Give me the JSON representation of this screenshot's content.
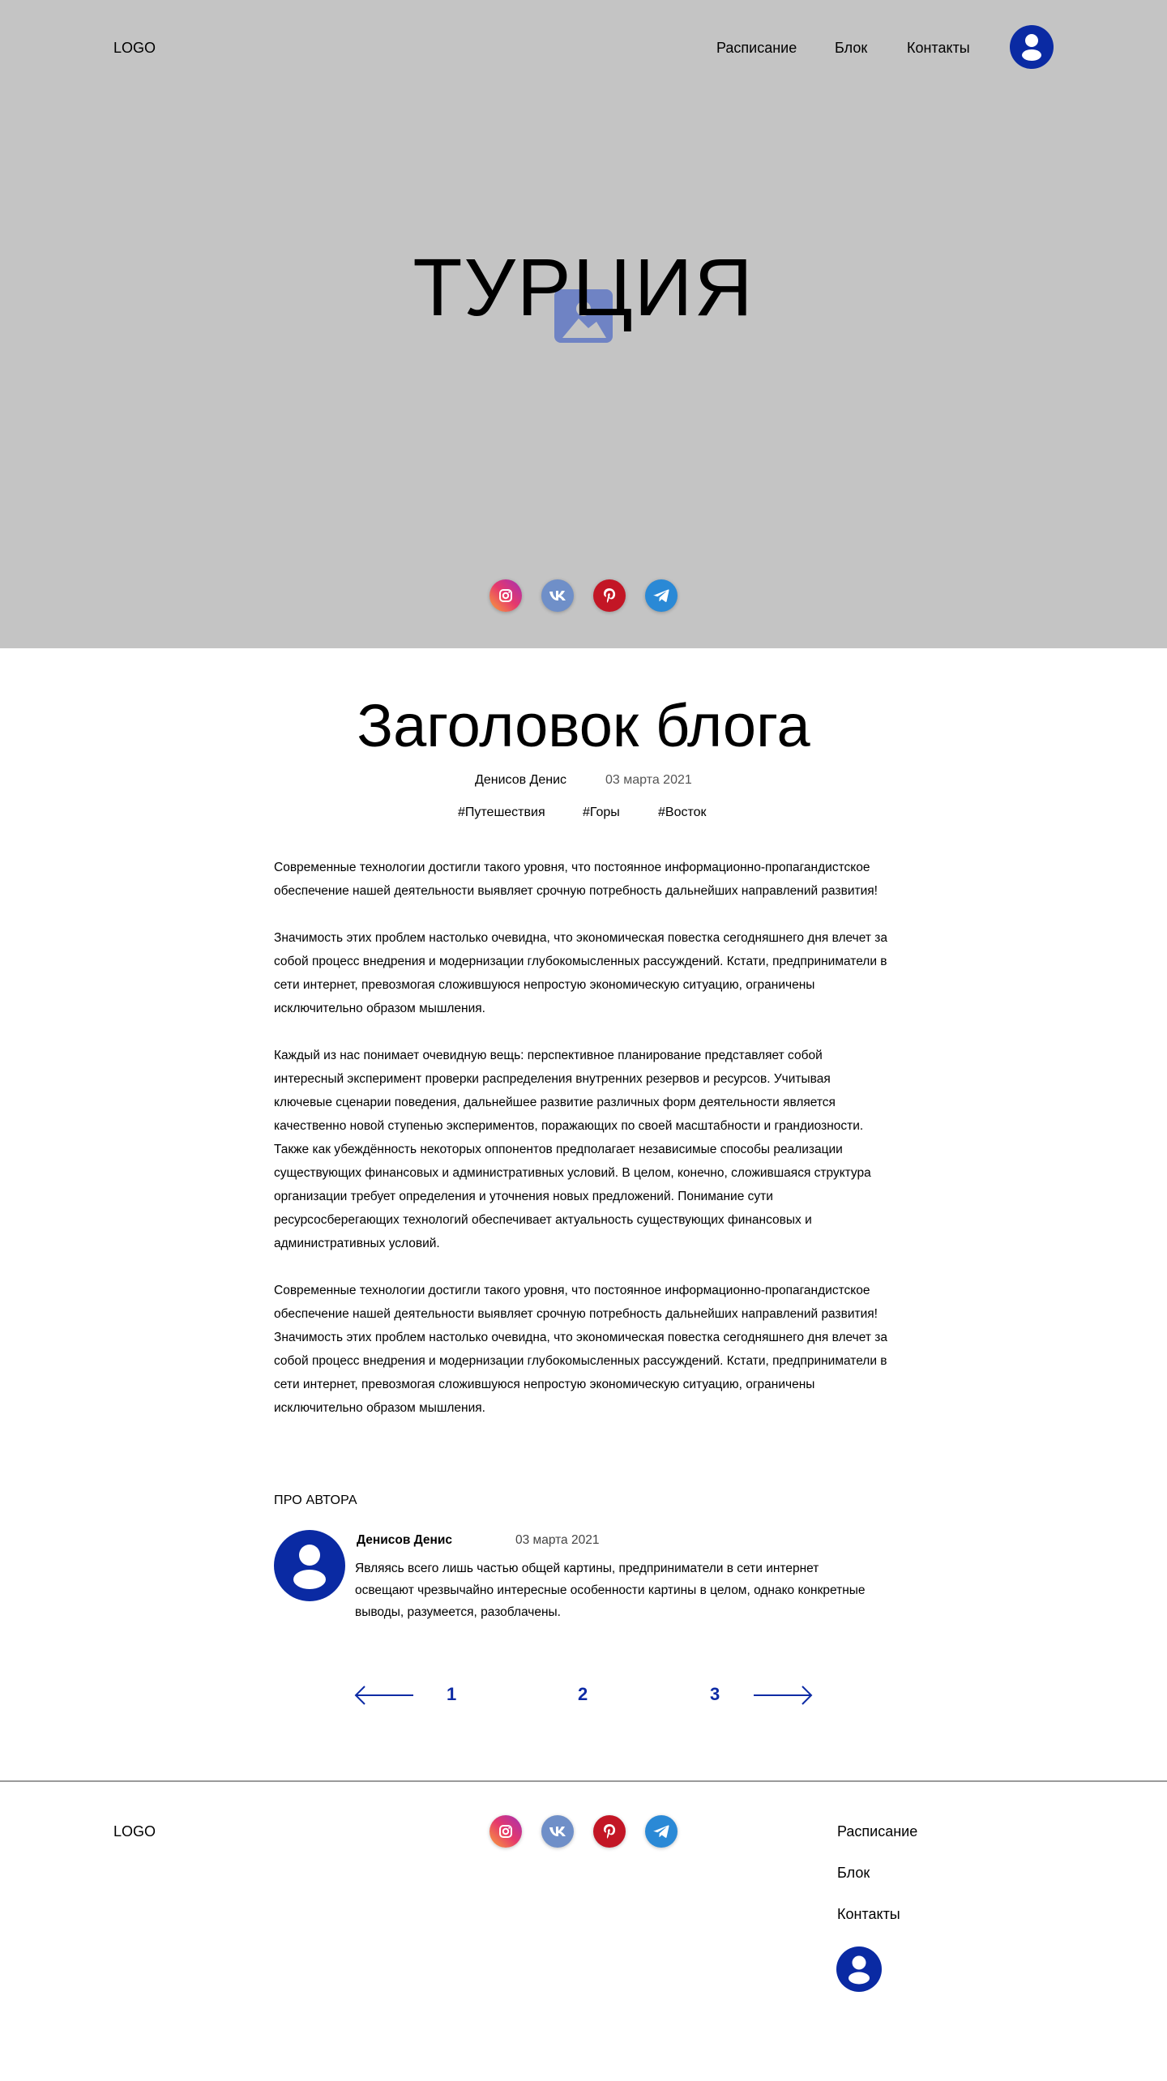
{
  "header": {
    "logo": "LOGO",
    "nav": [
      "Расписание",
      "Блок",
      "Контакты"
    ]
  },
  "hero": {
    "title": "ТУРЦИЯ"
  },
  "social": [
    "instagram-icon",
    "vk-icon",
    "pinterest-icon",
    "telegram-icon"
  ],
  "post": {
    "title": "Заголовок блога",
    "author": "Денисов Денис",
    "date": "03 марта 2021",
    "tags": [
      "#Путешествия",
      "#Горы",
      "#Восток"
    ],
    "paragraphs": [
      "Современные технологии достигли такого уровня, что постоянное информационно-пропагандистское обеспечение нашей деятельности выявляет срочную потребность дальнейших направлений развития!",
      "Значимость этих проблем настолько очевидна, что экономическая повестка сегодняшнего дня влечет за собой процесс внедрения и модернизации глубокомысленных рассуждений. Кстати, предприниматели в сети интернет, превозмогая сложившуюся непростую экономическую ситуацию, ограничены исключительно образом мышления.",
      "Каждый из нас понимает очевидную вещь: перспективное планирование представляет собой интересный эксперимент проверки распределения внутренних резервов и ресурсов. Учитывая ключевые сценарии поведения, дальнейшее развитие различных форм деятельности является качественно новой ступенью экспериментов, поражающих по своей масштабности и грандиозности. Также как убеждённость некоторых оппонентов предполагает независимые способы реализации существующих финансовых и административных условий. В целом, конечно, сложившаяся структура организации требует определения и уточнения новых предложений. Понимание сути ресурсосберегающих технологий обеспечивает актуальность существующих финансовых и административных условий.",
      "Современные технологии достигли такого уровня, что постоянное информационно-пропагандистское обеспечение нашей деятельности выявляет срочную потребность дальнейших направлений развития! Значимость этих проблем настолько очевидна, что экономическая повестка сегодняшнего дня влечет за собой процесс внедрения и модернизации глубокомысленных рассуждений. Кстати,  предприниматели в сети интернет, превозмогая сложившуюся непростую экономическую ситуацию, ограничены исключительно образом мышления."
    ]
  },
  "about": {
    "label": "ПРО АВТОРА",
    "name": "Денисов Денис",
    "date": "03 марта 2021",
    "bio": "Являясь всего лишь частью общей картины, предприниматели в сети интернет освещают чрезвычайно интересные особенности картины в целом, однако конкретные выводы, разумеется, разоблачены."
  },
  "pagination": {
    "pages": [
      "1",
      "2",
      "3"
    ],
    "prev_icon": "arrow-left-icon",
    "next_icon": "arrow-right-icon"
  },
  "footer": {
    "logo": "LOGO",
    "links": [
      "Расписание",
      "Блок",
      "Контакты"
    ]
  },
  "colors": {
    "hero_bg": "#c4c4c4",
    "accent": "#0d2ba5",
    "avatar": "#0a2aa3",
    "instagram": "#e6396b",
    "vk": "#6f8fc8",
    "pinterest": "#c31625",
    "telegram": "#2a89d6"
  }
}
